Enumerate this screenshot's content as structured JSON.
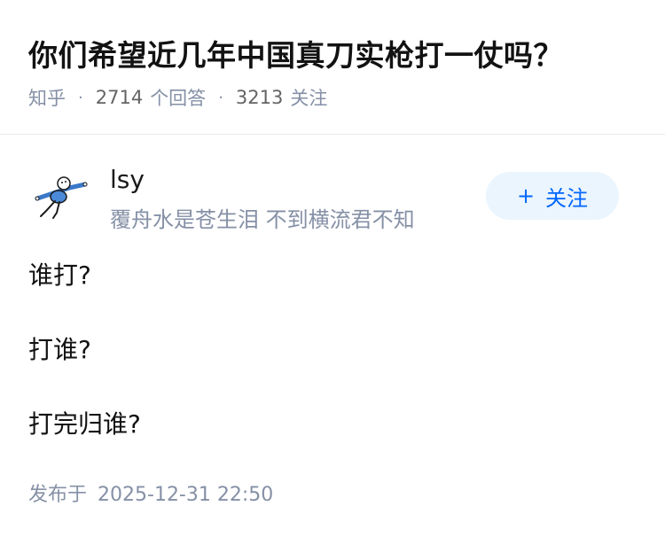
{
  "question": {
    "title": "你们希望近几年中国真刀实枪打一仗吗？",
    "source": "知乎",
    "answer_count": "2714",
    "answer_label": "个回答",
    "follow_count": "3213",
    "follow_label": "关注"
  },
  "author": {
    "name": "lsy",
    "bio": "覆舟水是苍生泪 不到横流君不知",
    "avatar_icon": "cartoon-figure-icon",
    "follow_button": {
      "icon": "+",
      "label": "关注"
    }
  },
  "answer": {
    "lines": [
      "谁打?",
      "打谁?",
      "打完归谁?"
    ]
  },
  "publish": {
    "label": "发布于",
    "datetime": "2025-12-31 22:50"
  },
  "colors": {
    "meta_gray": "#8590a6",
    "accent_blue": "#0066ff",
    "follow_bg": "#ebf5fd"
  }
}
